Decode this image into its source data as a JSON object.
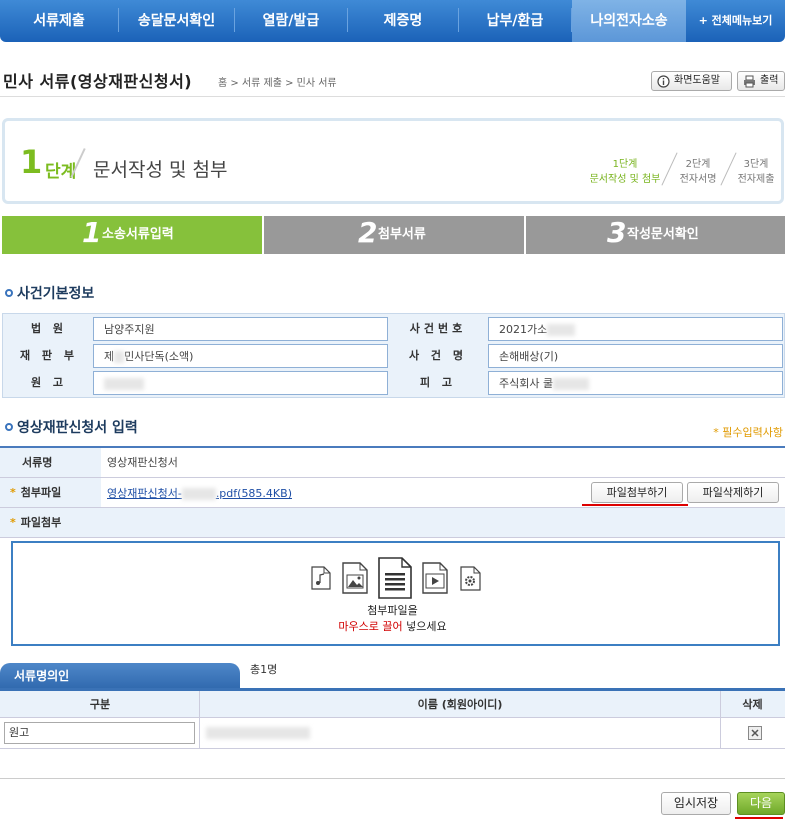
{
  "nav": {
    "items": [
      "서류제출",
      "송달문서확인",
      "열람/발급",
      "제증명",
      "납부/환급",
      "나의전자소송"
    ],
    "all_menu": "+ 전체메뉴보기"
  },
  "page": {
    "title": "민사 서류(영상재판신청서)",
    "breadcrumb": "홈 > 서류 제출 > 민사 서류",
    "help_label": "화면도움말",
    "print_label": "출력"
  },
  "stepbox": {
    "num": "1",
    "dan": "단계",
    "title": "문서작성 및 첨부",
    "steps": [
      {
        "line1": "1단계",
        "line2": "문서작성 및 첨부"
      },
      {
        "line1": "2단계",
        "line2": "전자서명"
      },
      {
        "line1": "3단계",
        "line2": "전자제출"
      }
    ]
  },
  "progress": [
    {
      "num": "1",
      "label": "소송서류입력"
    },
    {
      "num": "2",
      "label": "첨부서류"
    },
    {
      "num": "3",
      "label": "작성문서확인"
    }
  ],
  "case": {
    "section_title": "사건기본정보",
    "court_label": "법 원",
    "court_value": "남양주지원",
    "caseno_label": "사건번호",
    "caseno_value": "2021가소",
    "division_label": "재 판 부",
    "division_prefix": "제",
    "division_value": "민사단독(소액)",
    "casename_label": "사 건 명",
    "casename_value": "손해배상(기)",
    "plaintiff_label": "원 고",
    "defendant_label": "피 고",
    "defendant_value": "주식회사 쿨"
  },
  "form": {
    "section_title": "영상재판신청서 입력",
    "required_note": "* 필수입력사항",
    "docname_label": "서류명",
    "docname_value": "영상재판신청서",
    "attach_label": "첨부파일",
    "file_link_prefix": "영상재판신청서-",
    "file_link_suffix": ".pdf(585.4KB)",
    "attach_button": "파일첨부하기",
    "delete_button": "파일삭제하기",
    "fileattach_label": "파일첨부",
    "drop_line1": "첨부파일을",
    "drop_red": "마우스로 끌어",
    "drop_line2": "넣으세요"
  },
  "signers": {
    "tab_label": "서류명의인",
    "count": "총1명",
    "col_type": "구분",
    "col_name": "이름 (회원아이디)",
    "col_delete": "삭제",
    "row_type": "원고"
  },
  "footer": {
    "save_label": "임시저장",
    "next_label": "다음"
  }
}
